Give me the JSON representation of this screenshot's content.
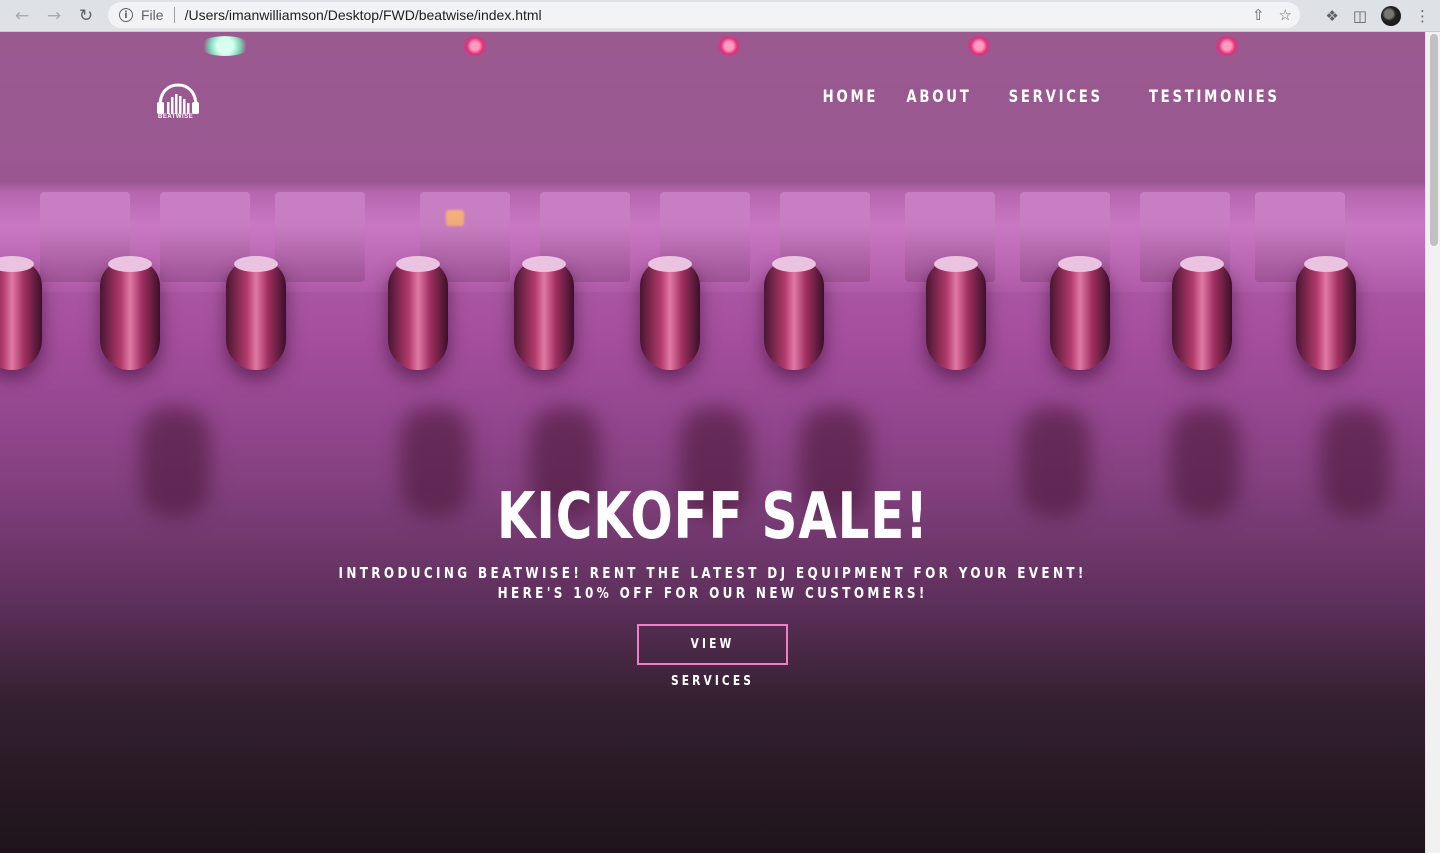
{
  "browser": {
    "back_icon": "arrow-left-icon",
    "forward_icon": "arrow-right-icon",
    "reload_icon": "reload-icon",
    "file_label": "File",
    "url": "/Users/imanwilliamson/Desktop/FWD/beatwise/index.html",
    "share_icon": "share-icon",
    "bookmark_icon": "star-icon",
    "extensions_icon": "puzzle-icon",
    "sidepanel_icon": "side-panel-icon",
    "menu_icon": "kebab-menu-icon"
  },
  "site": {
    "logo_text": "BEATWISE",
    "nav": [
      {
        "label": "HOME"
      },
      {
        "label": "ABOUT"
      },
      {
        "label": "SERVICES"
      },
      {
        "label": "TESTIMONIES"
      }
    ],
    "hero": {
      "title": "KICKOFF SALE!",
      "subtitle_line1": "INTRODUCING BEATWISE! RENT THE LATEST DJ EQUIPMENT FOR YOUR EVENT!",
      "subtitle_line2": "HERE'S 10% OFF FOR OUR NEW CUSTOMERS!",
      "cta_label": "VIEW SERVICES"
    }
  },
  "colors": {
    "accent": "#f07ec6",
    "hero_tint": "#a44d9d",
    "hero_dark": "#1e131b"
  }
}
